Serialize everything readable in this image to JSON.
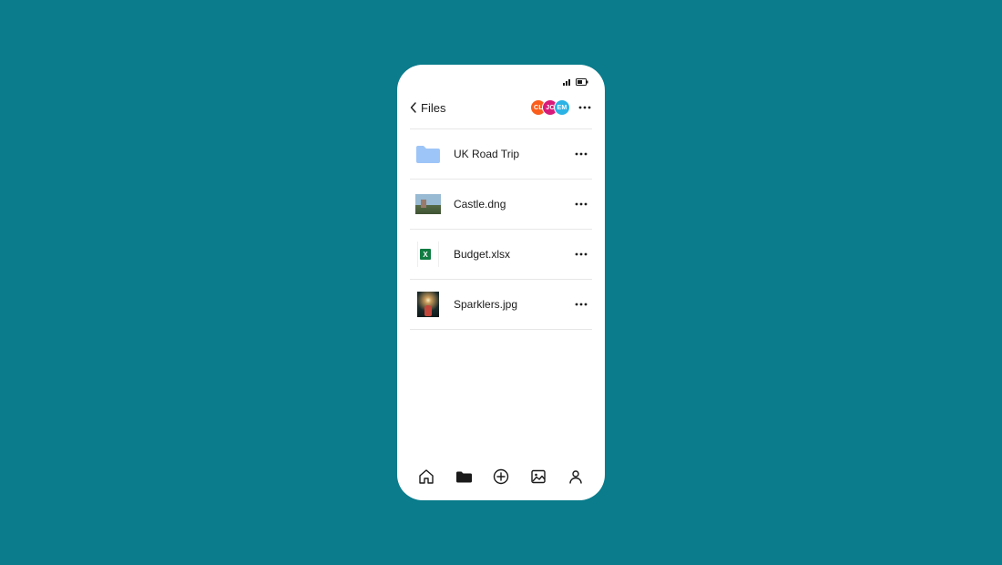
{
  "header": {
    "back_label": "Files"
  },
  "avatars": [
    {
      "initials": "CL",
      "color": "#fb5e1c"
    },
    {
      "initials": "JC",
      "color": "#d81b7a"
    },
    {
      "initials": "EM",
      "color": "#2bb3e6"
    }
  ],
  "files": [
    {
      "name": "UK Road Trip",
      "type": "folder"
    },
    {
      "name": "Castle.dng",
      "type": "image"
    },
    {
      "name": "Budget.xlsx",
      "type": "xlsx"
    },
    {
      "name": "Sparklers.jpg",
      "type": "image"
    }
  ],
  "xlsx_badge_letter": "X"
}
